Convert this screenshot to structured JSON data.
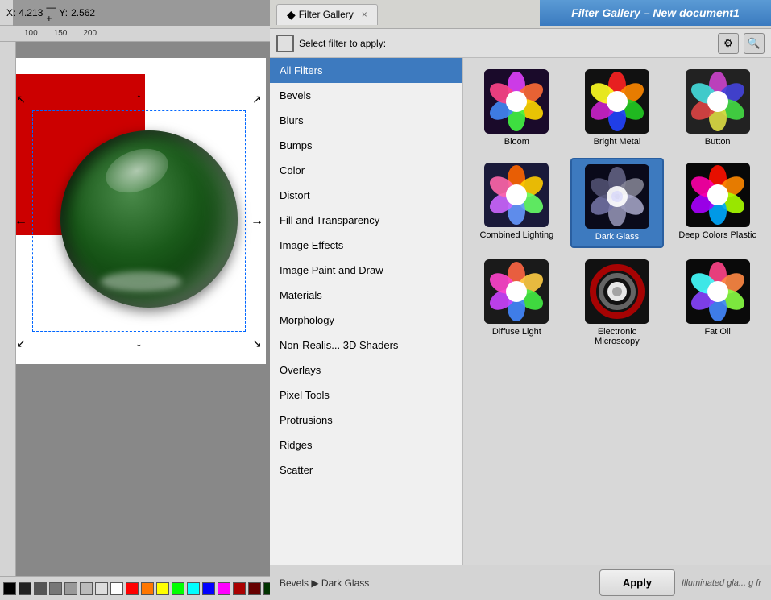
{
  "coordinates": {
    "x_label": "X:",
    "x_value": "4.213",
    "separator": "—+",
    "y_label": "Y:",
    "y_value": "2.562"
  },
  "ruler": {
    "marks": [
      "100",
      "150",
      "200"
    ]
  },
  "title_bar": {
    "text": "Filter Gallery – New document1"
  },
  "dialog": {
    "tab_icon": "◆",
    "tab_label": "Filter Gallery",
    "tab_close": "×",
    "toolbar": {
      "select_label": "Select filter to apply:",
      "gear_icon": "⚙",
      "search_icon": "🔍"
    }
  },
  "filter_list": {
    "items": [
      {
        "id": "all",
        "label": "All Filters",
        "active": true
      },
      {
        "id": "bevels",
        "label": "Bevels",
        "active": false
      },
      {
        "id": "blurs",
        "label": "Blurs",
        "active": false
      },
      {
        "id": "bumps",
        "label": "Bumps",
        "active": false
      },
      {
        "id": "color",
        "label": "Color",
        "active": false
      },
      {
        "id": "distort",
        "label": "Distort",
        "active": false
      },
      {
        "id": "fill",
        "label": "Fill and Transparency",
        "active": false
      },
      {
        "id": "image-effects",
        "label": "Image Effects",
        "active": false
      },
      {
        "id": "image-paint",
        "label": "Image Paint and Draw",
        "active": false
      },
      {
        "id": "materials",
        "label": "Materials",
        "active": false
      },
      {
        "id": "morphology",
        "label": "Morphology",
        "active": false
      },
      {
        "id": "non-realis",
        "label": "Non-Realis... 3D Shaders",
        "active": false
      },
      {
        "id": "overlays",
        "label": "Overlays",
        "active": false
      },
      {
        "id": "pixel-tools",
        "label": "Pixel Tools",
        "active": false
      },
      {
        "id": "protrusions",
        "label": "Protrusions",
        "active": false
      },
      {
        "id": "ridges",
        "label": "Ridges",
        "active": false
      },
      {
        "id": "scatter",
        "label": "Scatter",
        "active": false
      }
    ]
  },
  "filter_grid": {
    "items": [
      {
        "id": "bloom",
        "label": "Bloom",
        "selected": false,
        "colors": [
          "#e040fb",
          "#ff6b35",
          "#ffd700",
          "#42f542",
          "#4287f5"
        ]
      },
      {
        "id": "bright-metal",
        "label": "Bright Metal",
        "selected": false,
        "colors": [
          "#ff4040",
          "#ff8c00",
          "#40c040",
          "#4060ff",
          "#c040c0"
        ]
      },
      {
        "id": "button",
        "label": "Button",
        "selected": false,
        "colors": [
          "#cc44cc",
          "#4444dd",
          "#44dd44",
          "#dddd44",
          "#dd4444"
        ]
      },
      {
        "id": "combined-lighting",
        "label": "Combined Lighting",
        "selected": false,
        "colors": [
          "#ff6600",
          "#ffcc00",
          "#66ff66",
          "#6699ff",
          "#cc66ff"
        ]
      },
      {
        "id": "dark-glass",
        "label": "Dark Glass",
        "selected": true,
        "colors": [
          "#888888",
          "#aaaaaa",
          "#cccccc",
          "#666666",
          "#444444"
        ]
      },
      {
        "id": "deep-colors-plastic",
        "label": "Deep Colors Plastic",
        "selected": false,
        "colors": [
          "#ff2200",
          "#ff8800",
          "#aaff00",
          "#00aaff",
          "#aa00ff"
        ]
      },
      {
        "id": "diffuse-light",
        "label": "Diffuse Light",
        "selected": false,
        "colors": [
          "#ff6644",
          "#ffcc44",
          "#44ee44",
          "#4488ff",
          "#cc44ff"
        ]
      },
      {
        "id": "electronic-microscopy",
        "label": "Electronic Microscopy",
        "selected": false,
        "colors": [
          "#cc0000",
          "#ffffff",
          "#000000",
          "#aaaaaa",
          "#555555"
        ]
      },
      {
        "id": "fat-oil",
        "label": "Fat Oil",
        "selected": false,
        "colors": [
          "#ff4488",
          "#ff8844",
          "#88ff44",
          "#4488ff",
          "#8844ff"
        ]
      }
    ]
  },
  "bottom": {
    "breadcrumb": "Bevels ▶ Dark Glass",
    "apply_label": "Apply",
    "status_label": "Illuminated gla... g fr"
  },
  "color_swatches": [
    "#000000",
    "#222222",
    "#555555",
    "#777777",
    "#999999",
    "#bbbbbb",
    "#dddddd",
    "#ffffff",
    "#ff0000",
    "#ff7700",
    "#ffff00",
    "#00ff00",
    "#00ffff",
    "#0000ff",
    "#ff00ff",
    "#aa0000",
    "#660000",
    "#003300",
    "#004400",
    "#000088",
    "#333300",
    "#440044",
    "#006600",
    "#008888",
    "#880000"
  ]
}
